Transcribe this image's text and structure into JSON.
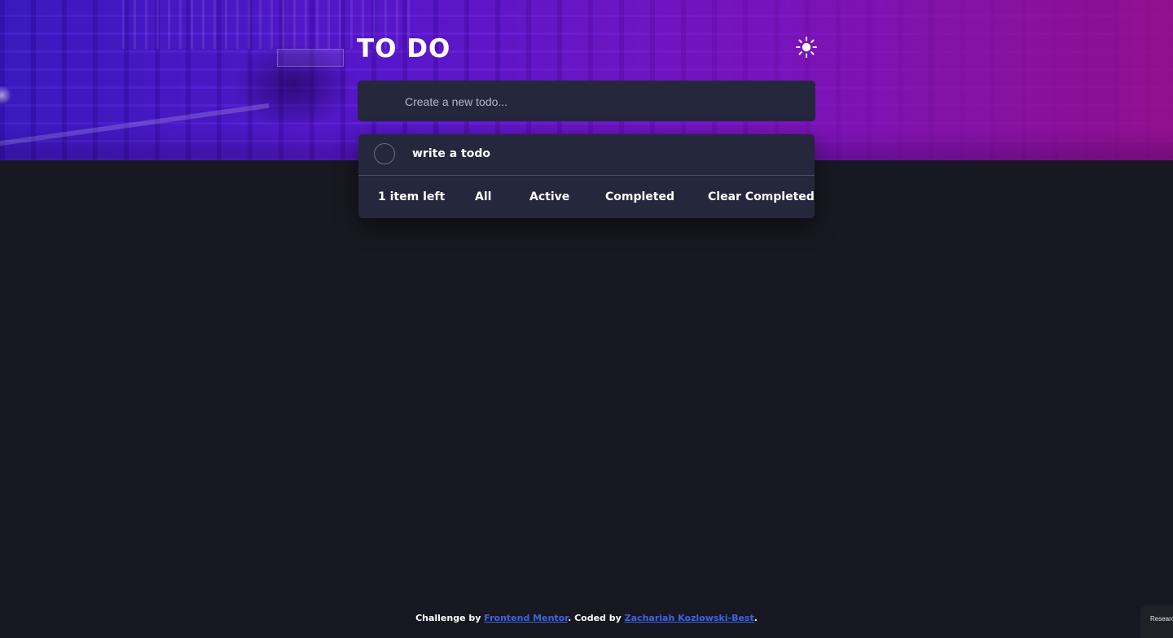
{
  "header": {
    "title": "TO DO",
    "theme_toggle_icon": "sun-icon"
  },
  "new_todo": {
    "placeholder": "Create a new todo...",
    "value": ""
  },
  "todos": [
    {
      "text": "write a todo",
      "completed": false
    }
  ],
  "footer": {
    "items_left": "1 item left",
    "filters": {
      "all": "All",
      "active": "Active",
      "completed": "Completed"
    },
    "clear_completed": "Clear Completed"
  },
  "attribution": {
    "prefix": "Challenge by",
    "challenge_link": "Frontend Mentor",
    "middle": ". Coded by",
    "author_link": "Zachariah Kozlowski-Best",
    "suffix": "."
  },
  "corner_widget": {
    "label": "Researc"
  },
  "colors": {
    "page_background": "#171821",
    "card_background": "#25273c",
    "link": "#3e63e8",
    "gradient_start": "#3a16c9",
    "gradient_end": "#92108e"
  }
}
